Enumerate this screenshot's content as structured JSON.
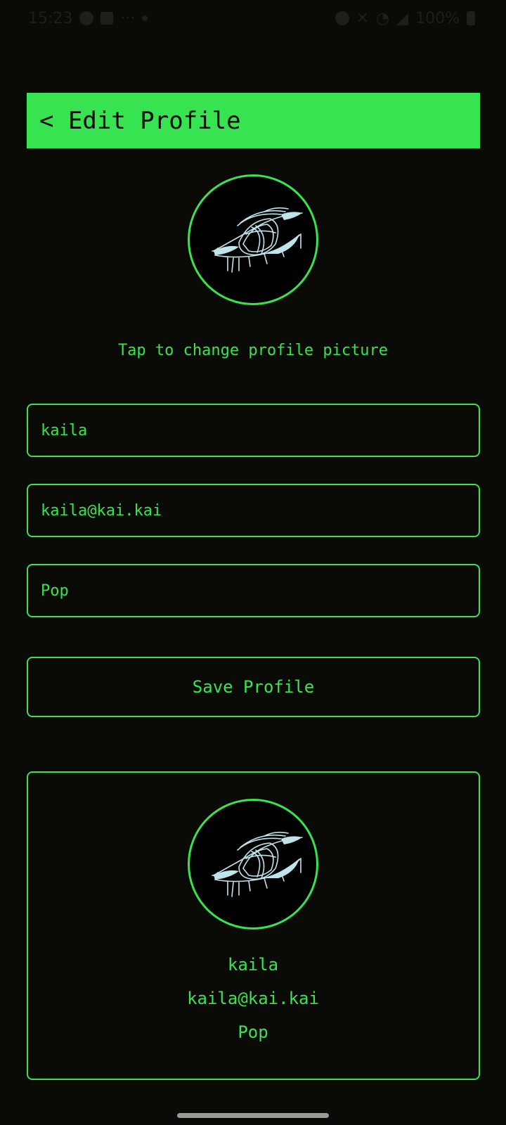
{
  "status_bar": {
    "time": "15:23",
    "battery": "100%"
  },
  "header": {
    "title": "< Edit Profile"
  },
  "profile_picture": {
    "hint": "Tap to change profile picture"
  },
  "form": {
    "name_value": "kaila",
    "email_value": "kaila@kai.kai",
    "genre_value": "Pop",
    "save_label": "Save Profile"
  },
  "preview": {
    "name": "kaila",
    "email": "kaila@kai.kai",
    "genre": "Pop"
  },
  "icons": {
    "avatar": "sketched-eye-image"
  },
  "colors": {
    "accent": "#3ae24f",
    "background": "#0a0b07",
    "sketch": "#bfe4ec"
  }
}
